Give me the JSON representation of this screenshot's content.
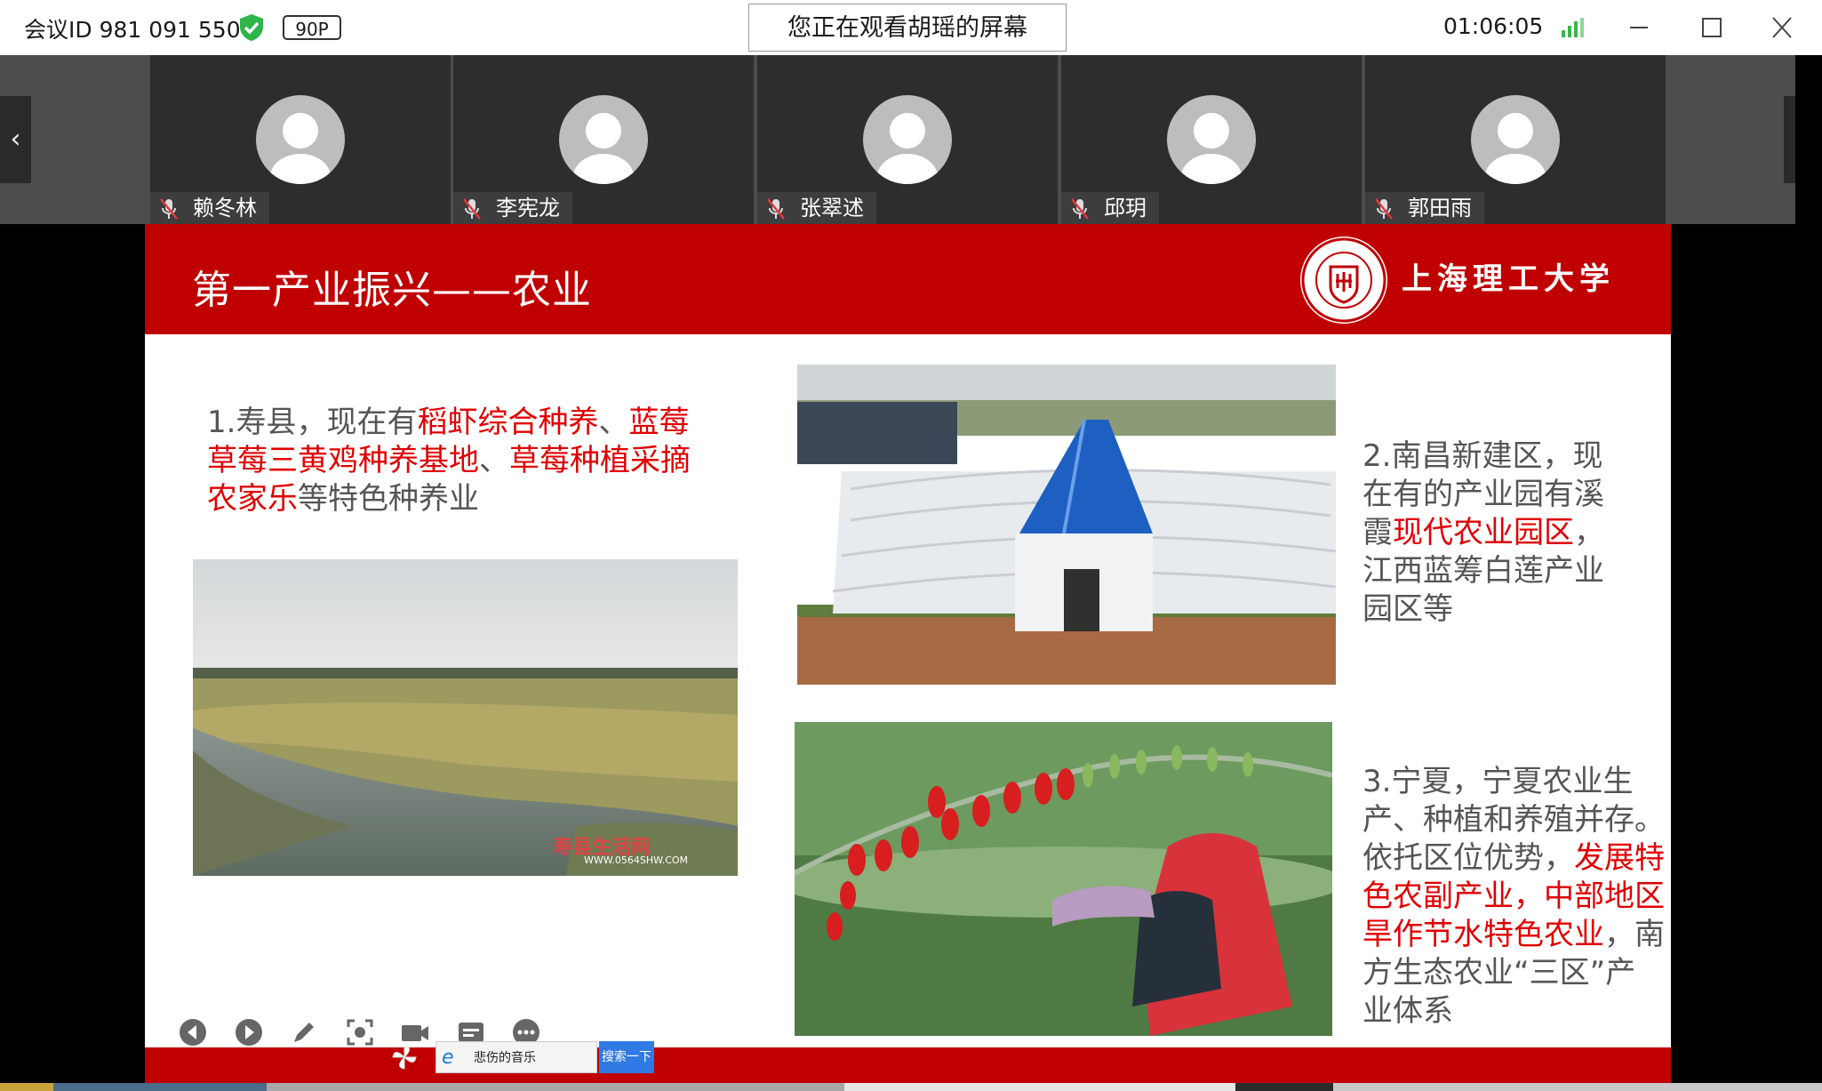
{
  "titlebar": {
    "meeting_id": "会议ID 981 091 550",
    "quality": "90P",
    "screen_banner": "您正在观看胡瑶的屏幕",
    "timer": "01:06:05",
    "icons": [
      "shield-check-icon",
      "signal-icon",
      "minimize-icon",
      "maximize-icon",
      "close-icon"
    ]
  },
  "participants": [
    {
      "name": "赖冬林",
      "mic": "muted"
    },
    {
      "name": "李宪龙",
      "mic": "muted"
    },
    {
      "name": "张翠述",
      "mic": "muted"
    },
    {
      "name": "邱玥",
      "mic": "muted"
    },
    {
      "name": "郭田雨",
      "mic": "muted"
    }
  ],
  "slide": {
    "title": "第一产业振兴——农业",
    "university": "上海理工大学",
    "para1": {
      "prefix": "1.寿县，现在有",
      "hl1": "稻虾综合种养",
      "sep": "、",
      "hl2": "蓝莓草莓三黄鸡种养基地",
      "sep2": "、",
      "hl3": "草莓种植采摘农家乐",
      "suffix": "等特色种养业"
    },
    "para2": {
      "prefix": "2.南昌新建区，现在有的产业园有溪霞",
      "hl1": "现代农业园区",
      "suffix": "，江西蓝筹白莲产业园区等"
    },
    "para3": {
      "prefix": "3.宁夏，宁夏农业生产、种植和养殖并存。依托区位优势，",
      "hl1": "发展特色农副产业，中部地区旱作节水特色农业",
      "suffix": "，南方生态农业“三区”产业体系"
    },
    "photo1_watermark": "寿县生活网",
    "photo1_watermark_url": "WWW.0564SHW.COM"
  },
  "presenter_toolbar": [
    "prev-icon",
    "next-icon",
    "pen-icon",
    "screenshot-icon",
    "camera-icon",
    "subtitle-icon",
    "more-icon"
  ],
  "taskbar": {
    "search_text": "悲伤的音乐",
    "search_button": "搜索一下"
  },
  "colors": {
    "brand_red": "#c00000",
    "highlight_red": "#e00000",
    "signal_green": "#3cb44a"
  }
}
